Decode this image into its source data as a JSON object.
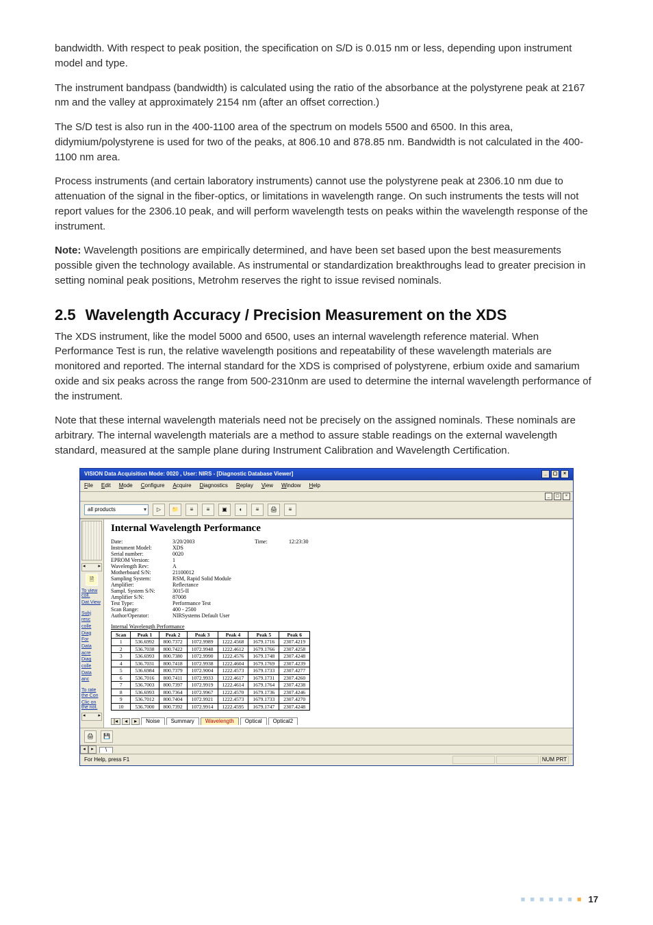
{
  "body": {
    "p1": "bandwidth. With respect to peak position, the specification on S/D is 0.015 nm or less, depending upon instrument model and type.",
    "p2": "The instrument bandpass (bandwidth) is calculated using the ratio of the absorbance at the polystyrene peak at 2167 nm and the valley at approximately 2154 nm (after an offset correction.)",
    "p3": "The S/D test is also run in the 400-1100 area of the spectrum on models 5500 and 6500. In this area, didymium/polystyrene is used for two of the peaks, at 806.10 and 878.85 nm. Bandwidth is not calculated in the 400-1100 nm area.",
    "p4": "Process instruments (and certain laboratory instruments) cannot use the polystyrene peak at 2306.10 nm due to attenuation of the signal in the fiber-optics, or limitations in wavelength range. On such instruments the tests will not report values for the 2306.10 peak, and will perform wavelength tests on peaks within the wavelength response of the instrument.",
    "p5_strong": "Note:",
    "p5_rest": " Wavelength positions are empirically determined, and have been set based upon the best measurements possible given the technology available. As instrumental or standardization breakthroughs lead to greater precision in setting nominal peak positions, Metrohm reserves the right to issue revised nominals.",
    "h2_num": "2.5",
    "h2_text": "Wavelength Accuracy / Precision Measurement on the XDS",
    "p6": "The XDS instrument, like the model 5000 and 6500, uses an internal wavelength reference material. When Performance Test is run, the relative wavelength positions and repeatability of these wavelength materials are monitored and reported. The internal standard for the XDS is comprised of polystyrene, erbium oxide and samarium oxide and six peaks across the range from 500-2310nm are used to determine the internal wavelength performance of the instrument.",
    "p7": "Note that these internal wavelength materials need not be precisely on the assigned nominals. These nominals are arbitrary. The internal wavelength materials are a method to assure stable readings on the external wavelength standard, measured at the sample plane during Instrument Calibration and Wavelength Certification."
  },
  "app": {
    "title": "VISION Data Acquisition Mode: 0020 , User: NIRS - [Diagnostic Database Viewer]",
    "menu": {
      "file": "File",
      "edit": "Edit",
      "mode": "Mode",
      "configure": "Configure",
      "acquire": "Acquire",
      "diagnostics": "Diagnostics",
      "replay": "Replay",
      "view": "View",
      "window": "Window",
      "help": "Help"
    },
    "combo": "all products",
    "report_title": "Internal Wavelength Performance",
    "meta": {
      "date_k": "Date:",
      "date_v": "3/20/2003",
      "time_k": "Time:",
      "time_v": "12:23:30",
      "instmodel_k": "Instrument Model:",
      "instmodel_v": "XDS",
      "serial_k": "Serial number:",
      "serial_v": "0020",
      "eprom_k": "EPROM Version:",
      "eprom_v": "1",
      "wrev_k": "Wavelength Rev:",
      "wrev_v": "A",
      "mb_k": "Motherboard S/N:",
      "mb_v": "21100012",
      "ss_k": "Sampling System:",
      "ss_v": "RSM, Rapid Solid Module",
      "amp_k": "Amplifier:",
      "amp_v": "Reflectance",
      "ssn_k": "Sampl. System S/N:",
      "ssn_v": "3015-II",
      "ampsn_k": "Amplifier S/N:",
      "ampsn_v": "87008",
      "tt_k": "Test Type:",
      "tt_v": "Performance Test",
      "range_k": "Scan Range:",
      "range_v": "400 - 2500",
      "auth_k": "Author/Operator:",
      "auth_v": "NIRSystems Default User"
    },
    "table_caption": "Internal Wavelength Performance",
    "cols": [
      "Scan",
      "Peak 1",
      "Peak 2",
      "Peak 3",
      "Peak 4",
      "Peak 5",
      "Peak 6"
    ],
    "rows": [
      [
        "1",
        "536.6992",
        "800.7372",
        "1072.9989",
        "1222.4568",
        "1679.1716",
        "2307.4219"
      ],
      [
        "2",
        "536.7038",
        "800.7422",
        "1072.9948",
        "1222.4612",
        "1679.1766",
        "2307.4258"
      ],
      [
        "3",
        "536.6993",
        "800.7380",
        "1072.9990",
        "1222.4576",
        "1679.1748",
        "2307.4248"
      ],
      [
        "4",
        "536.7031",
        "800.7418",
        "1072.9938",
        "1222.4604",
        "1679.1769",
        "2307.4239"
      ],
      [
        "5",
        "536.6984",
        "800.7379",
        "1072.9004",
        "1222.4573",
        "1679.1733",
        "2307.4277"
      ],
      [
        "6",
        "536.7016",
        "800.7411",
        "1072.9933",
        "1222.4617",
        "1679.1731",
        "2307.4260"
      ],
      [
        "7",
        "536.7003",
        "800.7397",
        "1072.9919",
        "1222.4614",
        "1679.1764",
        "2307.4238"
      ],
      [
        "8",
        "536.6993",
        "800.7364",
        "1072.9967",
        "1222.4570",
        "1679.1736",
        "2307.4246"
      ],
      [
        "9",
        "536.7012",
        "800.7404",
        "1072.9921",
        "1222.4573",
        "1679.1733",
        "2307.4270"
      ],
      [
        "10",
        "536.7000",
        "800.7392",
        "1072.9914",
        "1222.4595",
        "1679.1747",
        "2307.4248"
      ]
    ],
    "tabs": [
      "Noise",
      "Summary",
      "Wavelength",
      "Optical",
      "Optical2"
    ],
    "status_left": "For Help, press F1",
    "status_right": "NUM PRT",
    "left_links_a": [
      "To view coll.",
      "Dat.View"
    ],
    "left_links_b": [
      "Subj",
      "resc",
      "colle",
      "Diag",
      "For",
      "Data",
      "acre",
      "Diag",
      "colle",
      "Data",
      "anc"
    ],
    "left_links_c": [
      "To rate the Con",
      "Clic on the not."
    ]
  },
  "footer": {
    "page": "17"
  }
}
